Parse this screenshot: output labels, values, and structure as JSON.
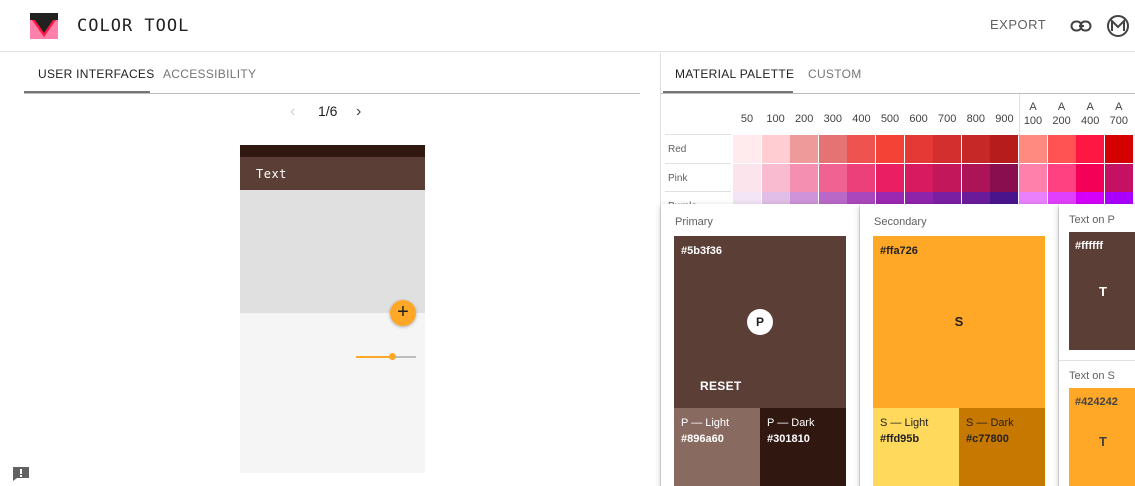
{
  "header": {
    "title": "COLOR TOOL",
    "export_label": "EXPORT"
  },
  "left_tabs": [
    {
      "label": "USER INTERFACES",
      "active": true
    },
    {
      "label": "ACCESSIBILITY",
      "active": false
    }
  ],
  "pager": {
    "prev": "‹",
    "page": "1/6",
    "next": "›"
  },
  "phone": {
    "appbar_text": "Text",
    "fab_glyph": "+",
    "slider_value": 0.6
  },
  "right_tabs": [
    {
      "label": "MATERIAL PALETTE",
      "active": true
    },
    {
      "label": "CUSTOM",
      "active": false
    }
  ],
  "palette": {
    "columns": [
      "50",
      "100",
      "200",
      "300",
      "400",
      "500",
      "600",
      "700",
      "800",
      "900"
    ],
    "accent_columns": [
      {
        "prefix": "A",
        "value": "100"
      },
      {
        "prefix": "A",
        "value": "200"
      },
      {
        "prefix": "A",
        "value": "400"
      },
      {
        "prefix": "A",
        "value": "700"
      }
    ],
    "rows": [
      {
        "name": "Red",
        "colors": [
          "#ffebee",
          "#ffcdd2",
          "#ef9a9a",
          "#e57373",
          "#ef5350",
          "#f44336",
          "#e53935",
          "#d32f2f",
          "#c62828",
          "#b71c1c",
          "#ff8a80",
          "#ff5252",
          "#ff1744",
          "#d50000"
        ]
      },
      {
        "name": "Pink",
        "colors": [
          "#fce4ec",
          "#f8bbd0",
          "#f48fb1",
          "#f06292",
          "#ec407a",
          "#e91e63",
          "#d81b60",
          "#c2185b",
          "#ad1457",
          "#880e4f",
          "#ff80ab",
          "#ff4081",
          "#f50057",
          "#c51162"
        ]
      },
      {
        "name": "Purple",
        "colors": [
          "#f3e5f5",
          "#e1bee7",
          "#ce93d8",
          "#ba68c8",
          "#ab47bc",
          "#9c27b0",
          "#8e24aa",
          "#7b1fa2",
          "#6a1b9a",
          "#4a148c",
          "#ea80fc",
          "#e040fb",
          "#d500f9",
          "#aa00ff"
        ]
      }
    ]
  },
  "primary": {
    "title": "Primary",
    "hex": "#5b3f36",
    "badge": "P",
    "reset_label": "RESET",
    "light": {
      "name": "P — Light",
      "hex": "#896a60"
    },
    "dark": {
      "name": "P — Dark",
      "hex": "#301810"
    }
  },
  "secondary": {
    "title": "Secondary",
    "hex": "#ffa726",
    "badge": "S",
    "light": {
      "name": "S — Light",
      "hex": "#ffd95b"
    },
    "dark": {
      "name": "S — Dark",
      "hex": "#c77800"
    }
  },
  "text_on_p": {
    "title": "Text on P",
    "hex": "#ffffff",
    "letter": "T"
  },
  "text_on_s": {
    "title": "Text on S",
    "hex": "#424242",
    "letter": "T"
  },
  "colors": {
    "primary": "#5b3f36",
    "primary_light": "#896a60",
    "primary_dark": "#301810",
    "secondary": "#ffa726",
    "secondary_light": "#ffd95b",
    "secondary_dark": "#c77800",
    "logo_pink": "#ff4081"
  },
  "icons": {
    "logo": "color-tool-logo-icon",
    "link": "link-icon",
    "m": "material-m-icon",
    "feedback": "feedback-icon"
  }
}
